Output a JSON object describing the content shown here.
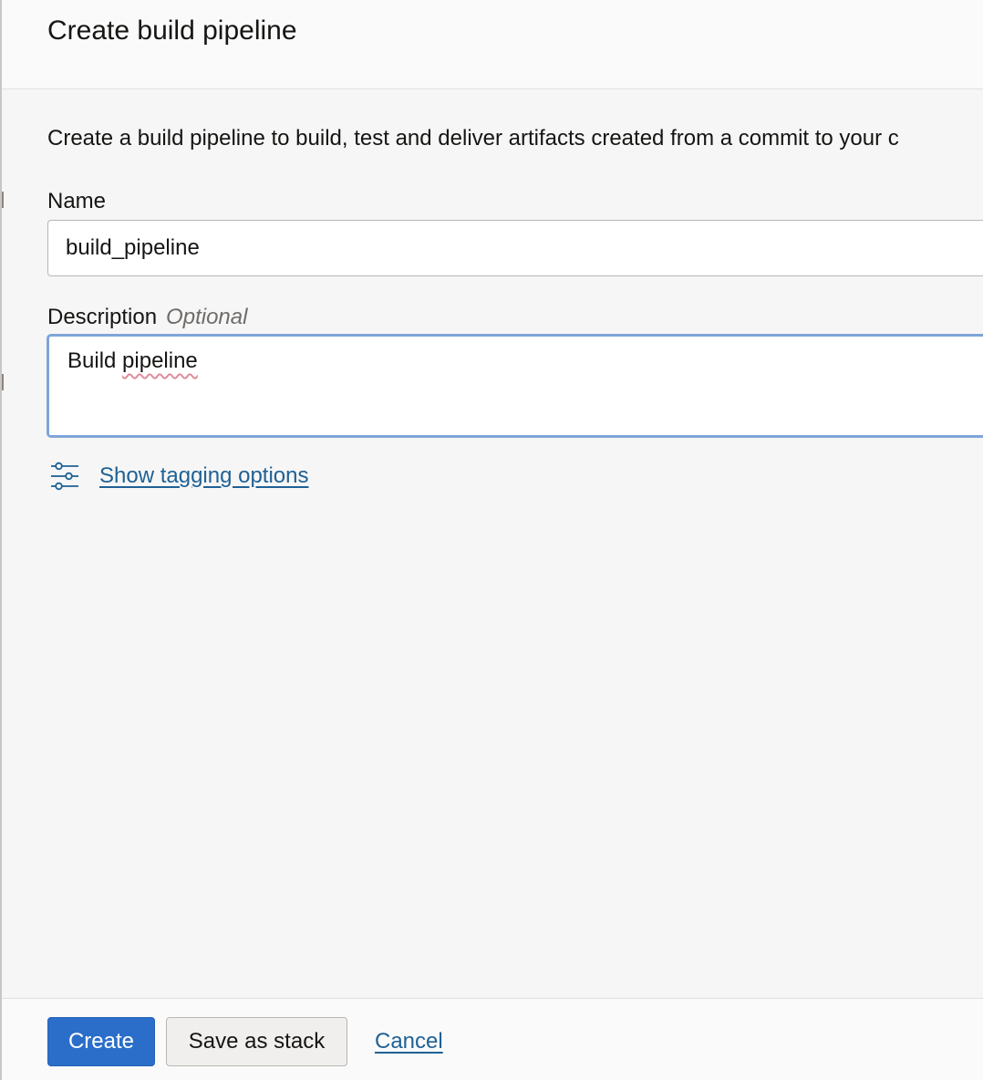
{
  "header": {
    "title": "Create build pipeline"
  },
  "form": {
    "intro": "Create a build pipeline to build, test and deliver artifacts created from a commit to your c",
    "name": {
      "label": "Name",
      "value": "build_pipeline"
    },
    "description": {
      "label": "Description",
      "optional_label": "Optional",
      "value_word1": "Build",
      "value_word2": "pipeline"
    },
    "tagging": {
      "icon": "sliders-icon",
      "link_label": "Show tagging options"
    }
  },
  "footer": {
    "create_label": "Create",
    "save_stack_label": "Save as stack",
    "cancel_label": "Cancel"
  },
  "colors": {
    "primary_button": "#2b6ec9",
    "link": "#1f6195",
    "focus_border": "#7fa5d9",
    "panel_background": "#f6f6f6"
  }
}
